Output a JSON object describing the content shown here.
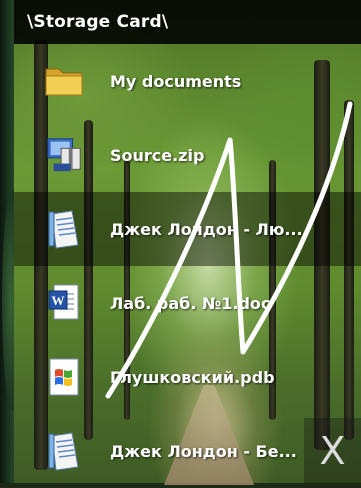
{
  "window": {
    "path": "\\Storage Card\\"
  },
  "files": [
    {
      "name": "My documents",
      "icon": "folder-icon"
    },
    {
      "name": "Source.zip",
      "icon": "zip-archive-icon"
    },
    {
      "name": "Джек Лондон - Лю...",
      "icon": "text-document-icon"
    },
    {
      "name": "Лаб. раб. №1.doc",
      "icon": "word-document-icon"
    },
    {
      "name": "Глушковский.pdb",
      "icon": "windows-document-icon"
    },
    {
      "name": "Джек Лондон - Бе...",
      "icon": "text-document-icon"
    }
  ],
  "close_button": {
    "label": "X"
  },
  "colors": {
    "titlebar": "#000000",
    "text": "#ffffff",
    "gesture_stroke": "#ffffff"
  }
}
